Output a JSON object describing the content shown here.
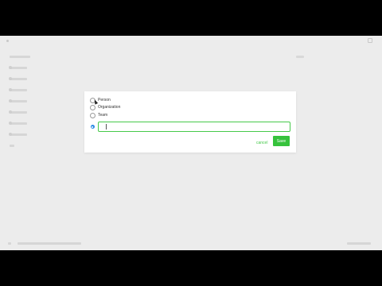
{
  "dialog": {
    "options": [
      {
        "label": "Person"
      },
      {
        "label": "Organization"
      },
      {
        "label": "Team"
      }
    ],
    "name_input": {
      "value": "",
      "placeholder": ""
    },
    "cancel_label": "cancel",
    "save_label": "Save"
  },
  "colors": {
    "accent_green": "#36c23c",
    "input_border": "#46c94a",
    "info_icon_blue": "#2e8ce6"
  },
  "icons": [
    "info-icon",
    "mouse-cursor-icon"
  ]
}
